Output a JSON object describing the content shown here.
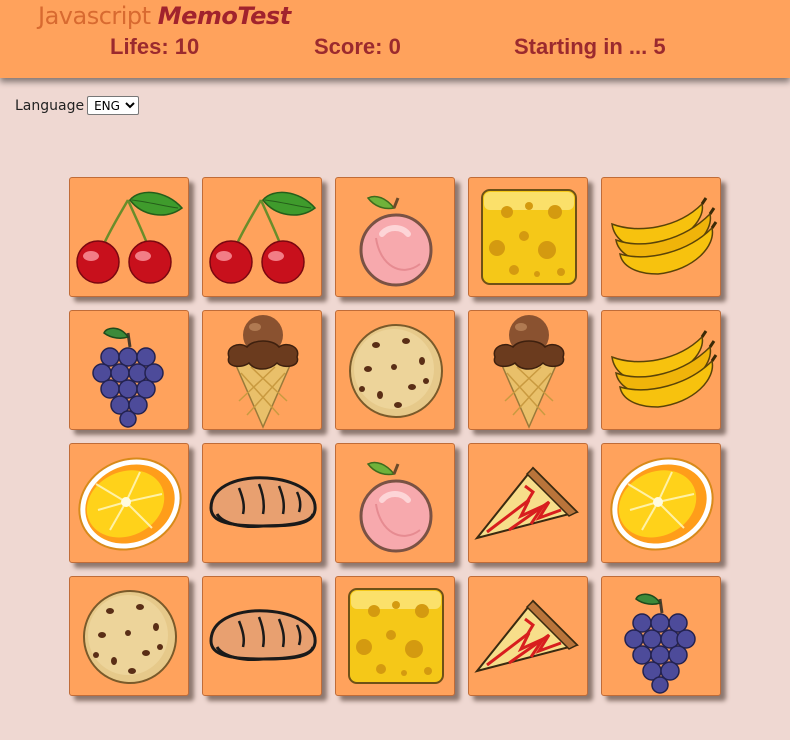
{
  "header": {
    "logo_part1": "Javascript",
    "logo_part2": "MemoTest",
    "lifes": "Lifes: 10",
    "score": "Score: 0",
    "countdown": "Starting in ... 5"
  },
  "language": {
    "label": "Language",
    "selected": "ENG"
  },
  "colors": {
    "header_bg": "#ffa25c",
    "page_bg": "#efd8d2",
    "card_bg": "#ffa25c",
    "stat_text": "#9b2a2e"
  },
  "board": {
    "rows": [
      [
        "cherry",
        "cherry",
        "peach",
        "cheese",
        "banana"
      ],
      [
        "grapes",
        "ice-cream",
        "cookie",
        "ice-cream",
        "banana"
      ],
      [
        "orange",
        "bread",
        "peach",
        "pizza",
        "orange"
      ],
      [
        "cookie",
        "bread",
        "cheese",
        "pizza",
        "grapes"
      ]
    ]
  }
}
